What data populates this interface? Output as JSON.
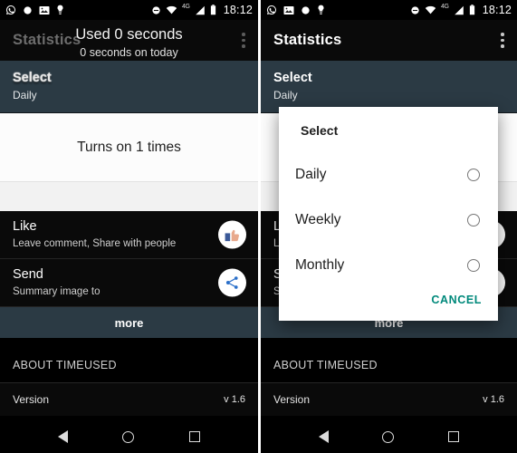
{
  "status_bar": {
    "time": "18:12",
    "network_label": "4G",
    "icons_left": [
      "whatsapp-icon",
      "circle-icon",
      "photo-icon",
      "bulb-icon"
    ],
    "icons_right": [
      "do-not-disturb-icon",
      "wifi-icon",
      "signal-icon",
      "battery-icon"
    ]
  },
  "app": {
    "title": "Statistics",
    "overflow_icon": "kebab-menu-icon"
  },
  "toast": {
    "main": "Used 0 seconds",
    "sub": "0 seconds on today"
  },
  "select_card": {
    "title": "Select",
    "value": "Daily"
  },
  "stat_panel": {
    "text": "Turns on 1 times"
  },
  "rows": [
    {
      "title": "Like",
      "subtitle": "Leave comment, Share with people",
      "icon": "thumbs-up-icon"
    },
    {
      "title": "Send",
      "subtitle": "Summary image to",
      "icon": "share-icon"
    }
  ],
  "more_button": {
    "label": "more"
  },
  "about": {
    "section_header": "ABOUT TIMEUSED",
    "version_label": "Version",
    "version_value": "v 1.6"
  },
  "nav_bar": {
    "back": "back-icon",
    "home": "home-icon",
    "recents": "recents-icon"
  },
  "dialog": {
    "title": "Select",
    "options": [
      {
        "label": "Daily",
        "selected": false
      },
      {
        "label": "Weekly",
        "selected": false
      },
      {
        "label": "Monthly",
        "selected": false
      }
    ],
    "cancel_label": "CANCEL"
  },
  "colors": {
    "accent_teal": "#00897b",
    "card_slate": "#2b3a44",
    "background_black": "#0a0a0a",
    "panel_white": "#fcfcfc"
  }
}
